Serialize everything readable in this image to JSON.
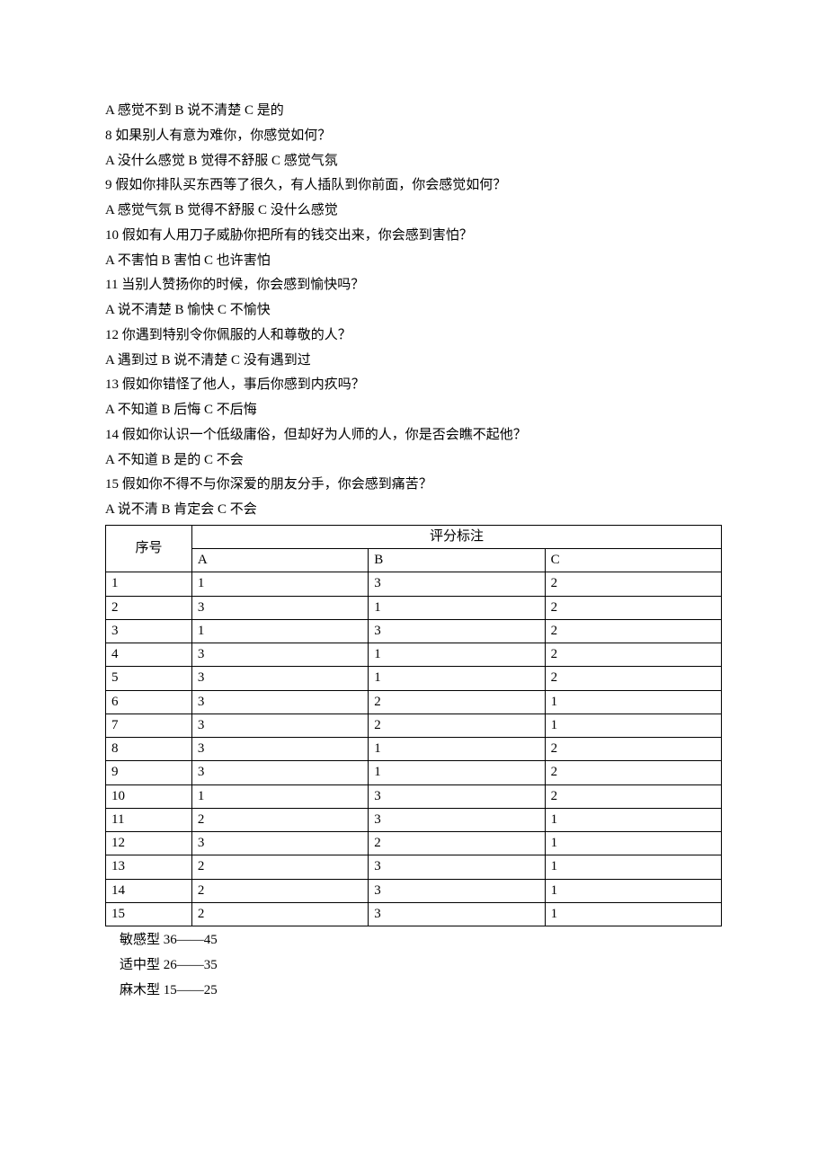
{
  "questions": [
    {
      "answers": "A 感觉不到 B 说不清楚 C 是的"
    },
    {
      "q": "8 如果别人有意为难你，你感觉如何？",
      "answers": "A 没什么感觉 B 觉得不舒服 C 感觉气氛"
    },
    {
      "q": "9 假如你排队买东西等了很久，有人插队到你前面，你会感觉如何？",
      "answers": "A 感觉气氛 B 觉得不舒服 C 没什么感觉"
    },
    {
      "q": "10 假如有人用刀子威胁你把所有的钱交出来，你会感到害怕？",
      "answers": "A 不害怕 B 害怕 C 也许害怕"
    },
    {
      "q": "11 当别人赞扬你的时候，你会感到愉快吗？",
      "answers": "A 说不清楚 B 愉快 C 不愉快"
    },
    {
      "q": "12 你遇到特别令你佩服的人和尊敬的人？",
      "answers": "A 遇到过 B 说不清楚 C 没有遇到过"
    },
    {
      "q": "13 假如你错怪了他人，事后你感到内疚吗？",
      "answers": "A 不知道 B 后悔 C 不后悔"
    },
    {
      "q": "14 假如你认识一个低级庸俗，但却好为人师的人，你是否会瞧不起他？",
      "answers": "A 不知道 B 是的 C 不会"
    },
    {
      "q": "15 假如你不得不与你深爱的朋友分手，你会感到痛苦？",
      "answers": "A 说不清 B 肯定会 C 不会"
    }
  ],
  "table": {
    "header_seq": "序号",
    "header_score": "评分标注",
    "col_a": "A",
    "col_b": "B",
    "col_c": "C",
    "rows": [
      {
        "n": "1",
        "a": "1",
        "b": "3",
        "c": "2"
      },
      {
        "n": "2",
        "a": "3",
        "b": "1",
        "c": "2"
      },
      {
        "n": "3",
        "a": "1",
        "b": "3",
        "c": "2"
      },
      {
        "n": "4",
        "a": "3",
        "b": "1",
        "c": "2"
      },
      {
        "n": "5",
        "a": "3",
        "b": "1",
        "c": "2"
      },
      {
        "n": "6",
        "a": "3",
        "b": "2",
        "c": "1"
      },
      {
        "n": "7",
        "a": "3",
        "b": "2",
        "c": "1"
      },
      {
        "n": "8",
        "a": "3",
        "b": "1",
        "c": "2"
      },
      {
        "n": "9",
        "a": "3",
        "b": "1",
        "c": "2"
      },
      {
        "n": "10",
        "a": "1",
        "b": "3",
        "c": "2"
      },
      {
        "n": "11",
        "a": "2",
        "b": "3",
        "c": "1"
      },
      {
        "n": "12",
        "a": "3",
        "b": "2",
        "c": "1"
      },
      {
        "n": "13",
        "a": "2",
        "b": "3",
        "c": "1"
      },
      {
        "n": "14",
        "a": "2",
        "b": "3",
        "c": "1"
      },
      {
        "n": "15",
        "a": "2",
        "b": "3",
        "c": "1"
      }
    ]
  },
  "results": {
    "sensitive": "敏感型 36——45",
    "moderate": "适中型  26——35",
    "numb": "麻木型  15——25"
  }
}
